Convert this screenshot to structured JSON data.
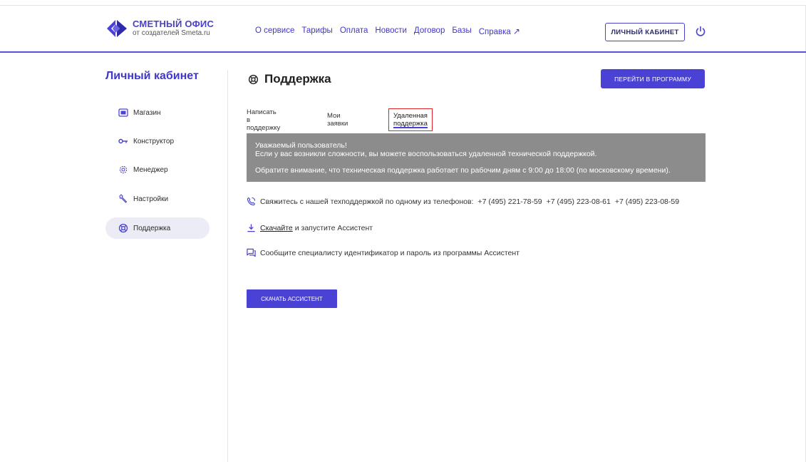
{
  "header": {
    "logo_title": "СМЕТНЫЙ ОФИС",
    "logo_subtitle": "от создателей Smeta.ru",
    "nav": [
      "О сервисе",
      "Тарифы",
      "Оплата",
      "Новости",
      "Договор",
      "Базы",
      "Справка"
    ],
    "nav_external_icon": "arrow-up-right-icon",
    "cabinet_button": "ЛИЧНЫЙ КАБИНЕТ",
    "power_icon": "power-icon",
    "accent_color": "#4a42d4"
  },
  "sidebar": {
    "title": "Личный кабинет",
    "items": [
      {
        "label": "Магазин",
        "icon": "store-icon",
        "active": false
      },
      {
        "label": "Конструктор",
        "icon": "key-icon",
        "active": false
      },
      {
        "label": "Менеджер",
        "icon": "gear-icon",
        "active": false
      },
      {
        "label": "Настройки",
        "icon": "wrench-icon",
        "active": false
      },
      {
        "label": "Поддержка",
        "icon": "lifebuoy-icon",
        "active": true
      }
    ]
  },
  "main": {
    "title": "Поддержка",
    "title_icon": "lifebuoy-icon",
    "goto_button": "ПЕРЕЙТИ В ПРОГРАММУ",
    "tabs": [
      {
        "label": "Написать в поддержку",
        "active": false
      },
      {
        "label": "Мои заявки",
        "active": false
      },
      {
        "label": "Удаленная поддержка",
        "active": true
      }
    ],
    "notice": {
      "line1": "Уважаемый пользователь!",
      "line2": "Если у вас возникли сложности, вы можете воспользоваться удаленной технической поддержкой.",
      "line3": "Обратите внимание, что техническая поддержка работает по рабочим дням с 9:00 до 18:00 (по московскому времени)."
    },
    "contact_text": "Свяжитесь с нашей техподдержкой по одному из телефонов:",
    "phones": [
      "+7 (495) 221-78-59",
      "+7 (495) 223-08-61",
      "+7 (495) 223-08-59"
    ],
    "download_link": "Скачайте",
    "download_rest": "и запустите Ассистент",
    "report_text": "Сообщите специалисту идентификатор и пароль из программы Ассистент",
    "download_button": "СКАЧАТЬ АССИСТЕНТ"
  }
}
